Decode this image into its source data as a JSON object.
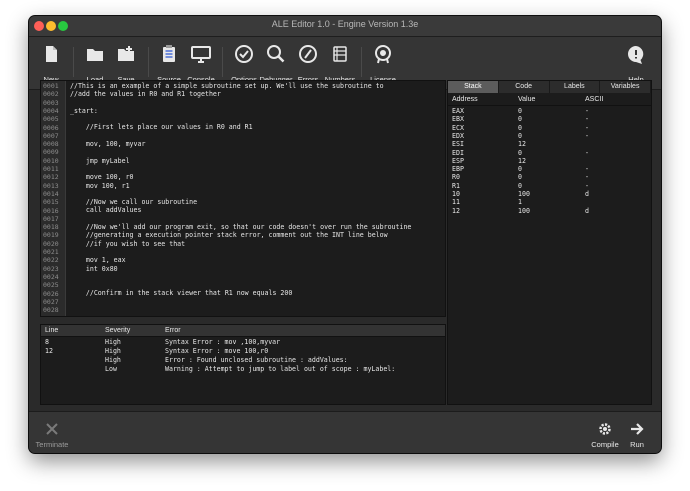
{
  "window": {
    "title": "ALE Editor 1.0 - Engine Version 1.3e"
  },
  "toolbar": {
    "new": "New",
    "load": "Load",
    "save": "Save",
    "source": "Source",
    "console": "Console",
    "options": "Options",
    "debugger": "Debugger",
    "errors": "Errors",
    "numbers": "Numbers",
    "license": "License",
    "help": "Help"
  },
  "editor": {
    "line_numbers": [
      "0001",
      "0002",
      "0003",
      "0004",
      "0005",
      "0006",
      "0007",
      "0008",
      "0009",
      "0010",
      "0011",
      "0012",
      "0013",
      "0014",
      "0015",
      "0016",
      "0017",
      "0018",
      "0019",
      "0020",
      "0021",
      "0022",
      "0023",
      "0024",
      "0025",
      "0026",
      "0027",
      "0028"
    ],
    "lines": [
      "//This is an example of a simple subroutine set up. We'll use the subroutine to",
      "//add the values in R0 and R1 together",
      "",
      "_start:",
      "",
      "    //First lets place our values in R0 and R1",
      "",
      "    mov, 100, myvar",
      "",
      "    jmp myLabel",
      "",
      "    move 100, r0",
      "    mov 100, r1",
      "",
      "    //Now we call our subroutine",
      "    call addValues",
      "",
      "    //Now we'll add our program exit, so that our code doesn't over run the subroutine",
      "    //generating a execution pointer stack error, comment out the INT line below",
      "    //if you wish to see that",
      "",
      "    mov 1, eax",
      "    int 0x80",
      "",
      "",
      "    //Confirm in the stack viewer that R1 now equals 200",
      "",
      ""
    ]
  },
  "errors": {
    "headers": {
      "line": "Line",
      "severity": "Severity",
      "error": "Error"
    },
    "rows": [
      {
        "line": "8",
        "severity": "High",
        "error": "Syntax Error : mov ,100,myvar"
      },
      {
        "line": "12",
        "severity": "High",
        "error": "Syntax Error : move 100,r0"
      },
      {
        "line": "",
        "severity": "High",
        "error": "Error : Found unclosed subroutine : addValues:"
      },
      {
        "line": "",
        "severity": "Low",
        "error": "Warning : Attempt to jump to label out of scope : myLabel:"
      }
    ]
  },
  "right_panel": {
    "tabs": [
      "Stack",
      "Code",
      "Labels",
      "Variables"
    ],
    "active_tab": "Stack",
    "headers": {
      "address": "Address",
      "value": "Value",
      "ascii": "ASCII"
    },
    "rows": [
      {
        "address": "EAX",
        "value": "0",
        "ascii": "-"
      },
      {
        "address": "EBX",
        "value": "0",
        "ascii": "-"
      },
      {
        "address": "ECX",
        "value": "0",
        "ascii": "-"
      },
      {
        "address": "EDX",
        "value": "0",
        "ascii": "-"
      },
      {
        "address": "ESI",
        "value": "12",
        "ascii": ""
      },
      {
        "address": "EDI",
        "value": "0",
        "ascii": "-"
      },
      {
        "address": "ESP",
        "value": "12",
        "ascii": ""
      },
      {
        "address": "EBP",
        "value": "0",
        "ascii": "-"
      },
      {
        "address": "R0",
        "value": "0",
        "ascii": "-"
      },
      {
        "address": "R1",
        "value": "0",
        "ascii": "-"
      },
      {
        "address": "10",
        "value": "100",
        "ascii": "d"
      },
      {
        "address": "11",
        "value": "1",
        "ascii": ""
      },
      {
        "address": "12",
        "value": "100",
        "ascii": "d"
      }
    ]
  },
  "bottombar": {
    "terminate": "Terminate",
    "compile": "Compile",
    "run": "Run"
  },
  "colors": {
    "window_bg": "#2a2a2a",
    "panel_bg": "#1c1c1c",
    "active_tab": "#5c5c5c",
    "disabled": "#7a7a7a"
  }
}
